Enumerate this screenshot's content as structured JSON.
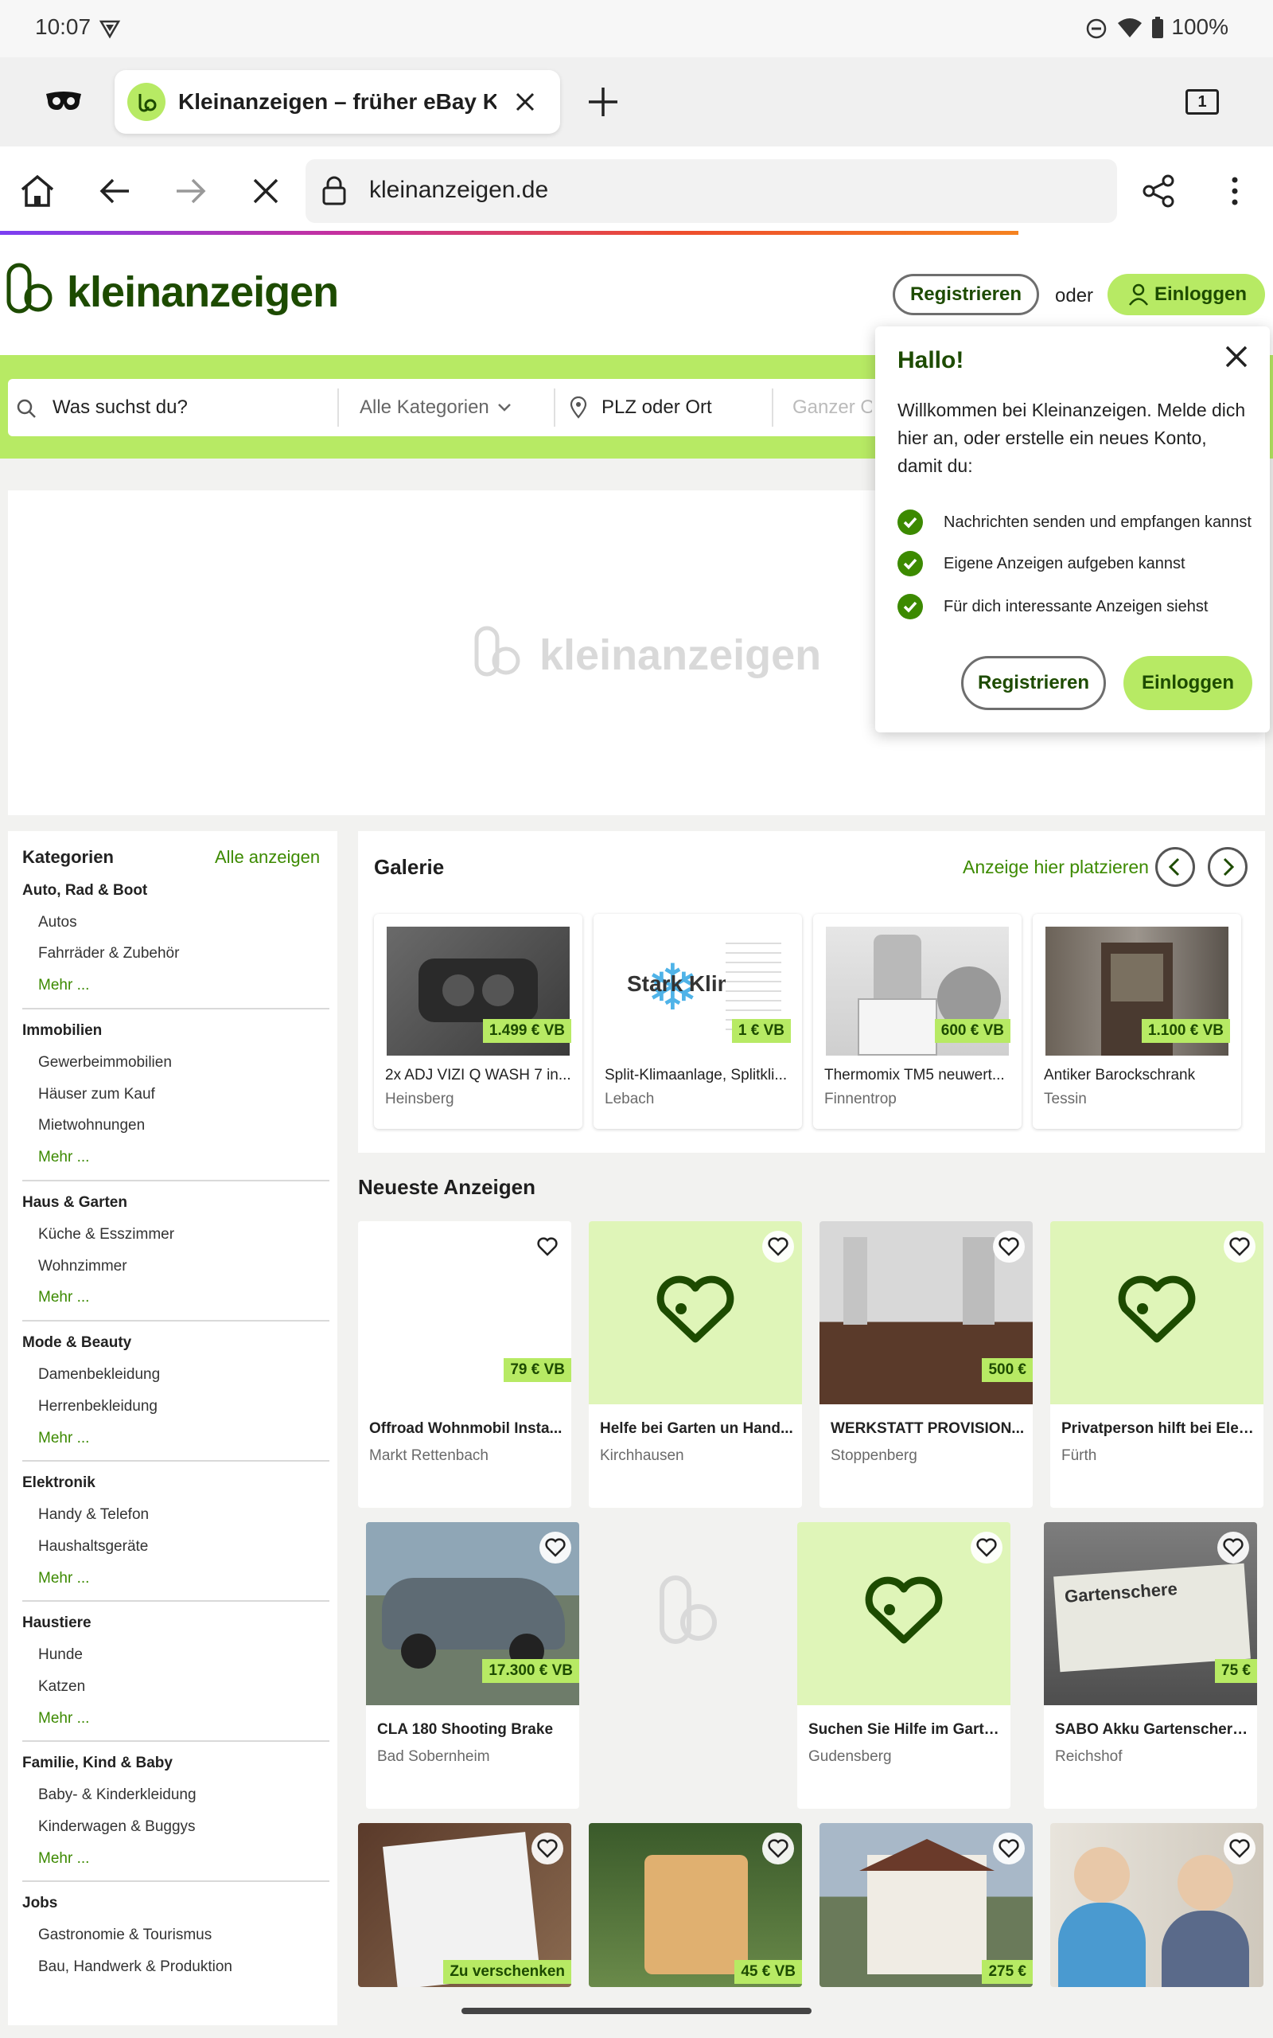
{
  "status_bar": {
    "time": "10:07",
    "battery": "100%"
  },
  "browser": {
    "tab_title": "Kleinanzeigen – früher eBay Kleinanzeigen",
    "tab_count": "1",
    "url": "kleinanzeigen.de"
  },
  "header": {
    "logo": "kleinanzeigen",
    "register_label": "Registrieren",
    "or_label": "oder",
    "login_label": "Einloggen"
  },
  "search": {
    "query_placeholder": "Was suchst du?",
    "category_value": "Alle Kategorien",
    "location_placeholder": "PLZ oder Ort",
    "radius_value": "Ganzer Ort"
  },
  "banner": {
    "logo": "kleinanzeigen"
  },
  "popover": {
    "title": "Hallo!",
    "intro": "Willkommen bei Kleinanzeigen. Melde dich hier an, oder erstelle ein neues Konto, damit du:",
    "features": [
      "Nachrichten senden und empfangen kannst",
      "Eigene Anzeigen aufgeben kannst",
      "Für dich interessante Anzeigen siehst"
    ],
    "register_label": "Registrieren",
    "login_label": "Einloggen"
  },
  "sidebar": {
    "title": "Kategorien",
    "all_label": "Alle anzeigen",
    "more_label": "Mehr ...",
    "categories": [
      {
        "name": "Auto, Rad & Boot",
        "subs": [
          "Autos",
          "Fahrräder & Zubehör"
        ]
      },
      {
        "name": "Immobilien",
        "subs": [
          "Gewerbeimmobilien",
          "Häuser zum Kauf",
          "Mietwohnungen"
        ]
      },
      {
        "name": "Haus & Garten",
        "subs": [
          "Küche & Esszimmer",
          "Wohnzimmer"
        ]
      },
      {
        "name": "Mode & Beauty",
        "subs": [
          "Damenbekleidung",
          "Herrenbekleidung"
        ]
      },
      {
        "name": "Elektronik",
        "subs": [
          "Handy & Telefon",
          "Haushaltsgeräte"
        ]
      },
      {
        "name": "Haustiere",
        "subs": [
          "Hunde",
          "Katzen"
        ]
      },
      {
        "name": "Familie, Kind & Baby",
        "subs": [
          "Baby- & Kinderkleidung",
          "Kinderwagen & Buggys"
        ]
      },
      {
        "name": "Jobs",
        "subs": [
          "Gastronomie & Tourismus",
          "Bau, Handwerk & Produktion"
        ]
      }
    ]
  },
  "gallery": {
    "title": "Galerie",
    "promo_label": "Anzeige hier platzieren",
    "items": [
      {
        "title": "2x ADJ VIZI Q WASH 7 in...",
        "location": "Heinsberg",
        "price": "1.499 € VB"
      },
      {
        "title": "Split-Klimaanlage, Splitkli...",
        "location": "Lebach",
        "price": "1 € VB",
        "image_text": "Stark Klima"
      },
      {
        "title": "Thermomix TM5 neuwert...",
        "location": "Finnentrop",
        "price": "600 € VB"
      },
      {
        "title": "Antiker Barockschrank",
        "location": "Tessin",
        "price": "1.100 € VB"
      }
    ]
  },
  "newest": {
    "title": "Neueste Anzeigen",
    "items": [
      {
        "title": "Offroad Wohnmobil Insta...",
        "location": "Markt Rettenbach",
        "price": "79 € VB"
      },
      {
        "title": "Helfe bei Garten un Hand...",
        "location": "Kirchhausen",
        "price": ""
      },
      {
        "title": "WERKSTATT PROVISION...",
        "location": "Stoppenberg",
        "price": "500 €"
      },
      {
        "title": "Privatperson hilft bei Elek...",
        "location": "Fürth",
        "price": ""
      },
      {
        "title": "CLA 180 Shooting Brake",
        "location": "Bad Sobernheim",
        "price": "17.300 € VB"
      },
      {
        "title": "Suchen Sie Hilfe im Garte...",
        "location": "Gudensberg",
        "price": ""
      },
      {
        "title": "SABO Akku Gartenschere ...",
        "location": "Reichshof",
        "price": "75 €",
        "image_text": "Gartenschere"
      },
      {
        "title": "",
        "location": "",
        "price": "Zu verschenken"
      },
      {
        "title": "",
        "location": "",
        "price": "45 € VB"
      },
      {
        "title": "",
        "location": "",
        "price": "275 €"
      },
      {
        "title": "",
        "location": "",
        "price": ""
      }
    ]
  },
  "colors": {
    "brand_green": "#b7ea64",
    "brand_dark": "#1d4b00",
    "accent": "#3c8a00"
  }
}
